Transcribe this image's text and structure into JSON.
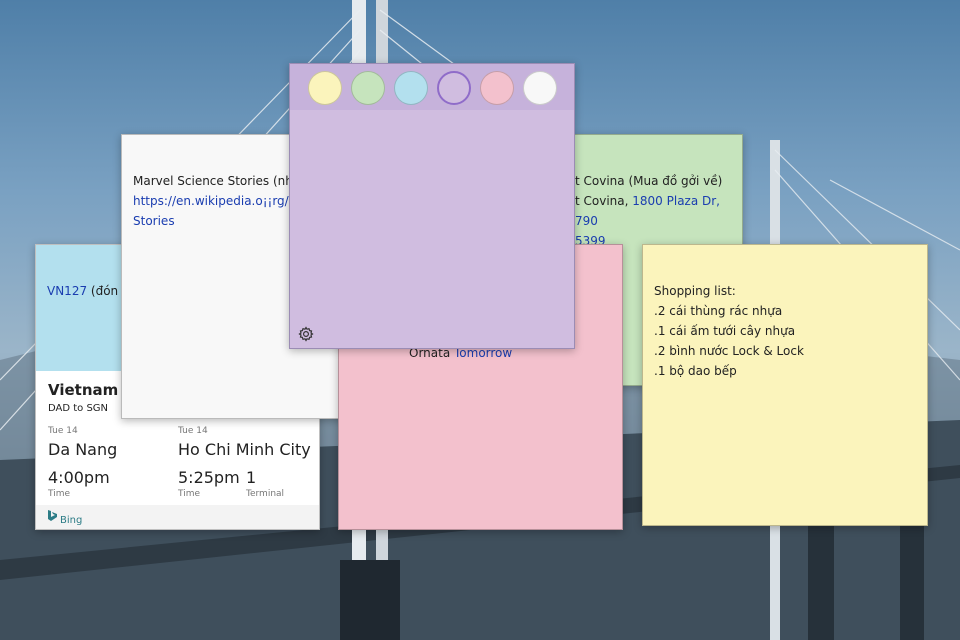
{
  "notes": {
    "flight": {
      "flight_code": "VN127",
      "flight_rest": " (đón p",
      "card_title": "Vietnam A",
      "route": "DAD to SGN",
      "depart": {
        "date": "Tue 14",
        "city": "Da Nang",
        "time": "4:00pm",
        "time_label": "Time"
      },
      "arrive": {
        "date": "Tue 14",
        "city": "Ho Chi Minh City",
        "time": "5:25pm",
        "time_label": "Time",
        "terminal": "1",
        "terminal_label": "Terminal"
      },
      "footer": "Bing"
    },
    "marvel": {
      "line1": "Marvel Science Stories (nhớ c",
      "line2": "https://en.wikipedia.o¡¡rg/wil",
      "line3": "Stories"
    },
    "pink": {
      "text": "Ornata ",
      "link": "Tomorrow",
      "side_num": "399"
    },
    "green": {
      "line1": "t Covina (Mua đồ gởi về)",
      "line2a": "t Covina, ",
      "line2b": "1800 Plaza Dr,",
      "line3": "790",
      "line4": "5399"
    },
    "purple": {
      "palette": [
        {
          "name": "yellow",
          "color": "#fbf4bc"
        },
        {
          "name": "green",
          "color": "#c6e4bd"
        },
        {
          "name": "blue",
          "color": "#b3e0ee"
        },
        {
          "name": "purple",
          "color": "#d0bde0"
        },
        {
          "name": "pink",
          "color": "#f3c1cd"
        },
        {
          "name": "white",
          "color": "#f8f8f8"
        }
      ],
      "selected": "purple",
      "settings_icon": "gear-icon"
    },
    "yellow": {
      "lines": [
        "Shopping list:",
        ".2 cái thùng rác nhựa",
        ".1 cái ấm tưới cây nhựa",
        ".2 bình nước Lock & Lock",
        ".1 bộ dao bếp"
      ]
    }
  }
}
